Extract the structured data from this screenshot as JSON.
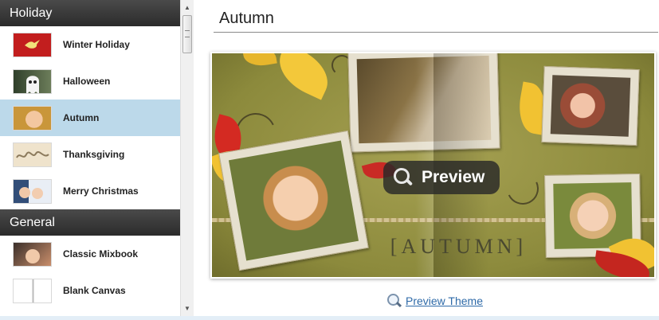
{
  "sidebar": {
    "categories": [
      {
        "title": "Holiday",
        "items": [
          {
            "label": "Winter Holiday",
            "thumb": "dove-on-red-icon"
          },
          {
            "label": "Halloween",
            "thumb": "ghost-icon"
          },
          {
            "label": "Autumn",
            "thumb": "child-photo",
            "selected": true
          },
          {
            "label": "Thanksgiving",
            "thumb": "script-text-photo"
          },
          {
            "label": "Merry Christmas",
            "thumb": "children-winter-photo"
          }
        ]
      },
      {
        "title": "General",
        "items": [
          {
            "label": "Classic Mixbook",
            "thumb": "girl-photo"
          },
          {
            "label": "Blank Canvas",
            "thumb": "blank-book-icon"
          }
        ]
      }
    ]
  },
  "main": {
    "title": "Autumn",
    "preview_overlay_label": "Preview",
    "book_text": "[AUTUMN]",
    "preview_theme_link": "Preview Theme"
  },
  "colors": {
    "selected_row": "#bcd9ea",
    "header_dark": "#2b2b2b",
    "link_blue": "#2e6aa8"
  }
}
